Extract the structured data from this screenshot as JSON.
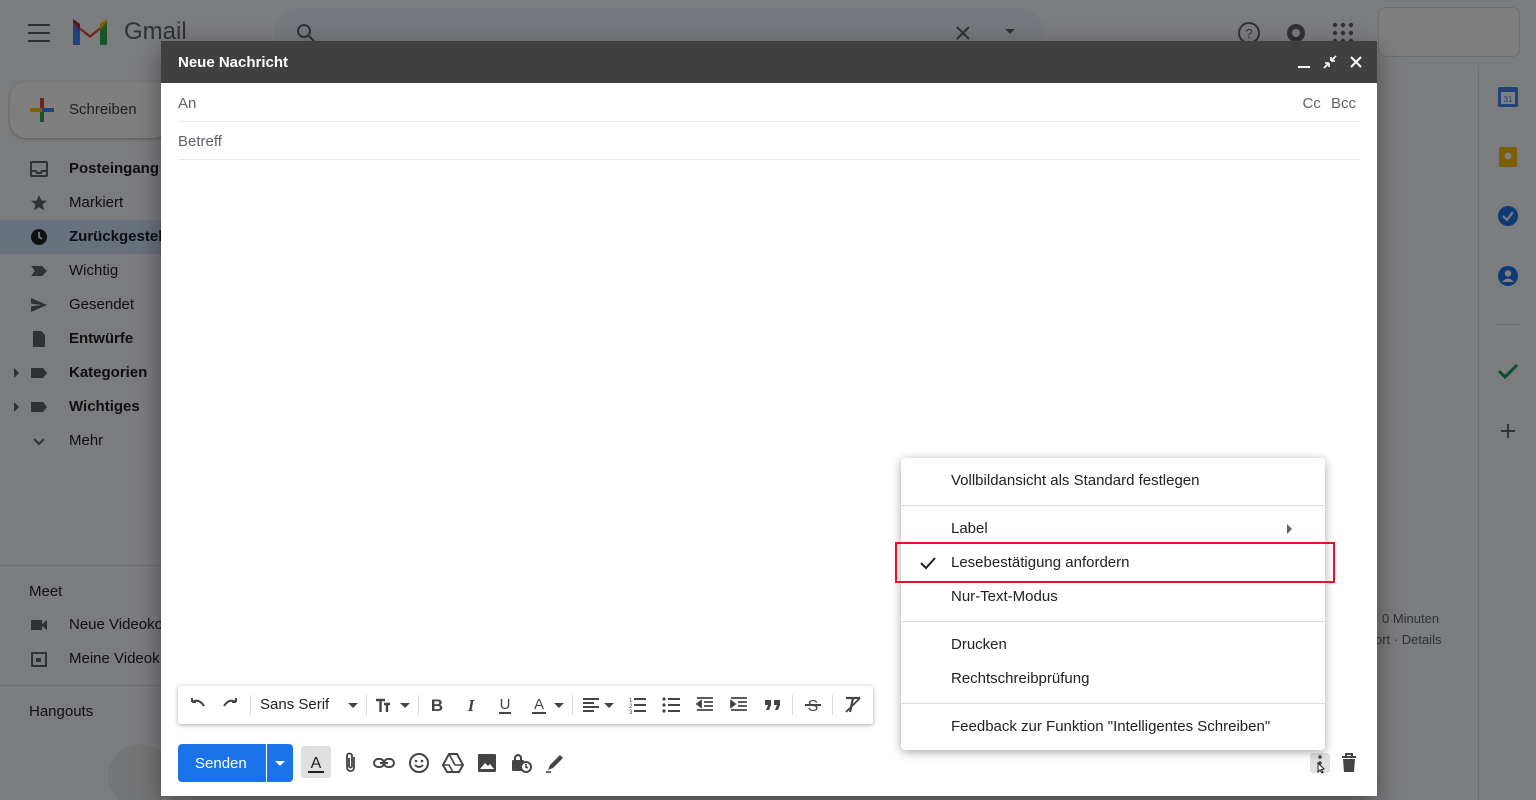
{
  "app": {
    "brand": "Gmail"
  },
  "nav": {
    "compose_label": "Schreiben",
    "items": [
      {
        "label": "Posteingang",
        "icon": "inbox-icon",
        "bold": true
      },
      {
        "label": "Markiert",
        "icon": "star-icon",
        "bold": false
      },
      {
        "label": "Zurückgestel",
        "icon": "clock-icon",
        "bold": true
      },
      {
        "label": "Wichtig",
        "icon": "important-icon",
        "bold": false
      },
      {
        "label": "Gesendet",
        "icon": "send-icon",
        "bold": false
      },
      {
        "label": "Entwürfe",
        "icon": "draft-icon",
        "bold": true
      },
      {
        "label": "Kategorien",
        "icon": "label-icon",
        "bold": true
      },
      {
        "label": "Wichtiges",
        "icon": "label-icon",
        "bold": true
      },
      {
        "label": "Mehr",
        "icon": "chevron-down-icon",
        "bold": false
      }
    ],
    "meet_heading": "Meet",
    "meet_items": [
      {
        "label": "Neue Videoko",
        "icon": "video-icon"
      },
      {
        "label": "Meine Videok",
        "icon": "calendar-icon"
      }
    ],
    "hangouts_heading": "Hangouts"
  },
  "background": {
    "line1": "0 Minuten",
    "line2": "ort · Details"
  },
  "compose": {
    "title": "Neue Nachricht",
    "to_label": "An",
    "cc_label": "Cc",
    "bcc_label": "Bcc",
    "subject_label": "Betreff",
    "font_name": "Sans Serif",
    "send_label": "Senden"
  },
  "menu": {
    "items": [
      {
        "label": "Vollbildansicht als Standard festlegen",
        "checked": false,
        "submenu": false
      },
      {
        "label": "Label",
        "checked": false,
        "submenu": true
      },
      {
        "label": "Lesebestätigung anfordern",
        "checked": true,
        "submenu": false
      },
      {
        "label": "Nur-Text-Modus",
        "checked": false,
        "submenu": false
      },
      {
        "label": "Drucken",
        "checked": false,
        "submenu": false
      },
      {
        "label": "Rechtschreibprüfung",
        "checked": false,
        "submenu": false
      },
      {
        "label": "Feedback zur Funktion \"Intelligentes Schreiben\"",
        "checked": false,
        "submenu": false
      }
    ]
  },
  "colors": {
    "send_blue": "#1a73e8",
    "header_dark": "#404040",
    "highlight_red": "#e8132a"
  }
}
